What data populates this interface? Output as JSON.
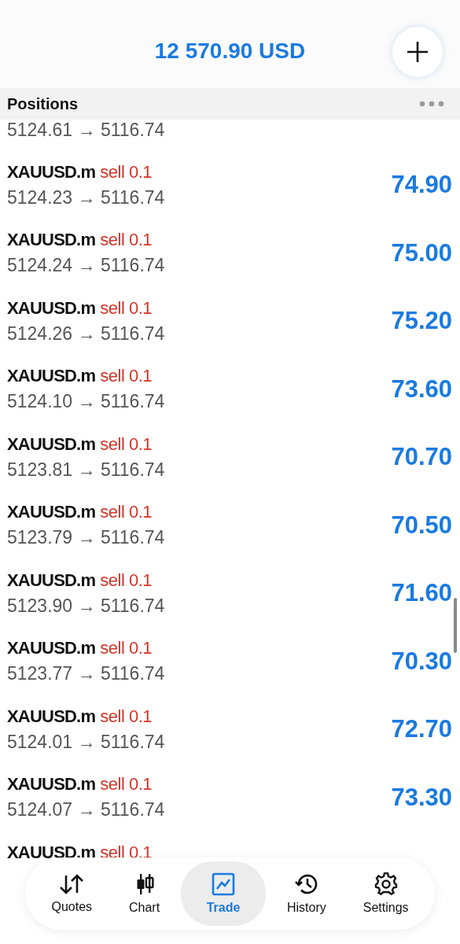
{
  "header": {
    "balance": "12 570.90 USD"
  },
  "section": {
    "title": "Positions"
  },
  "positions": [
    {
      "kind": "prices-only",
      "prices": "5124.61 → 5116.74"
    },
    {
      "kind": "full",
      "symbol": "XAUUSD.m",
      "side": "sell 0.1",
      "prices": "5124.23 → 5116.74",
      "profit": "74.90"
    },
    {
      "kind": "full",
      "symbol": "XAUUSD.m",
      "side": "sell 0.1",
      "prices": "5124.24 → 5116.74",
      "profit": "75.00"
    },
    {
      "kind": "full",
      "symbol": "XAUUSD.m",
      "side": "sell 0.1",
      "prices": "5124.26 → 5116.74",
      "profit": "75.20"
    },
    {
      "kind": "full",
      "symbol": "XAUUSD.m",
      "side": "sell 0.1",
      "prices": "5124.10 → 5116.74",
      "profit": "73.60"
    },
    {
      "kind": "full",
      "symbol": "XAUUSD.m",
      "side": "sell 0.1",
      "prices": "5123.81 → 5116.74",
      "profit": "70.70"
    },
    {
      "kind": "full",
      "symbol": "XAUUSD.m",
      "side": "sell 0.1",
      "prices": "5123.79 → 5116.74",
      "profit": "70.50"
    },
    {
      "kind": "full",
      "symbol": "XAUUSD.m",
      "side": "sell 0.1",
      "prices": "5123.90 → 5116.74",
      "profit": "71.60"
    },
    {
      "kind": "full",
      "symbol": "XAUUSD.m",
      "side": "sell 0.1",
      "prices": "5123.77 → 5116.74",
      "profit": "70.30"
    },
    {
      "kind": "full",
      "symbol": "XAUUSD.m",
      "side": "sell 0.1",
      "prices": "5124.01 → 5116.74",
      "profit": "72.70"
    },
    {
      "kind": "full",
      "symbol": "XAUUSD.m",
      "side": "sell 0.1",
      "prices": "5124.07 → 5116.74",
      "profit": "73.30"
    },
    {
      "kind": "symbol-only",
      "symbol": "XAUUSD.m",
      "side": "sell 0.1"
    }
  ],
  "tabs": [
    {
      "kind": "quotes",
      "label": "Quotes",
      "selected": false
    },
    {
      "kind": "chart",
      "label": "Chart",
      "selected": false
    },
    {
      "kind": "trade",
      "label": "Trade",
      "selected": true
    },
    {
      "kind": "history",
      "label": "History",
      "selected": false
    },
    {
      "kind": "settings",
      "label": "Settings",
      "selected": false
    }
  ]
}
